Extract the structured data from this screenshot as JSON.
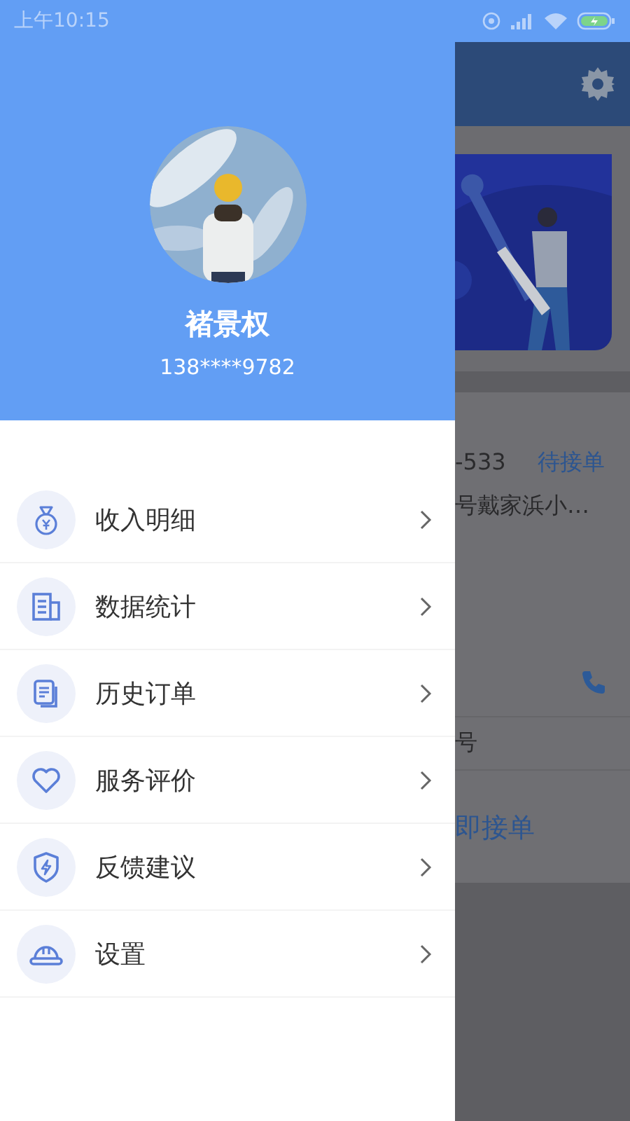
{
  "status_bar": {
    "time": "上午10:15"
  },
  "drawer": {
    "profile": {
      "name": "褚景权",
      "phone": "138****9782"
    },
    "menu": [
      {
        "label": "收入明细",
        "kind": "income"
      },
      {
        "label": "数据统计",
        "kind": "stats"
      },
      {
        "label": "历史订单",
        "kind": "orders"
      },
      {
        "label": "服务评价",
        "kind": "rating"
      },
      {
        "label": "反馈建议",
        "kind": "feedback"
      },
      {
        "label": "设置",
        "kind": "settings"
      }
    ]
  },
  "background_screen": {
    "order": {
      "number": "-533",
      "status": "待接单",
      "address": "号戴家浜小…",
      "note": "号",
      "action": "即接单"
    }
  }
}
